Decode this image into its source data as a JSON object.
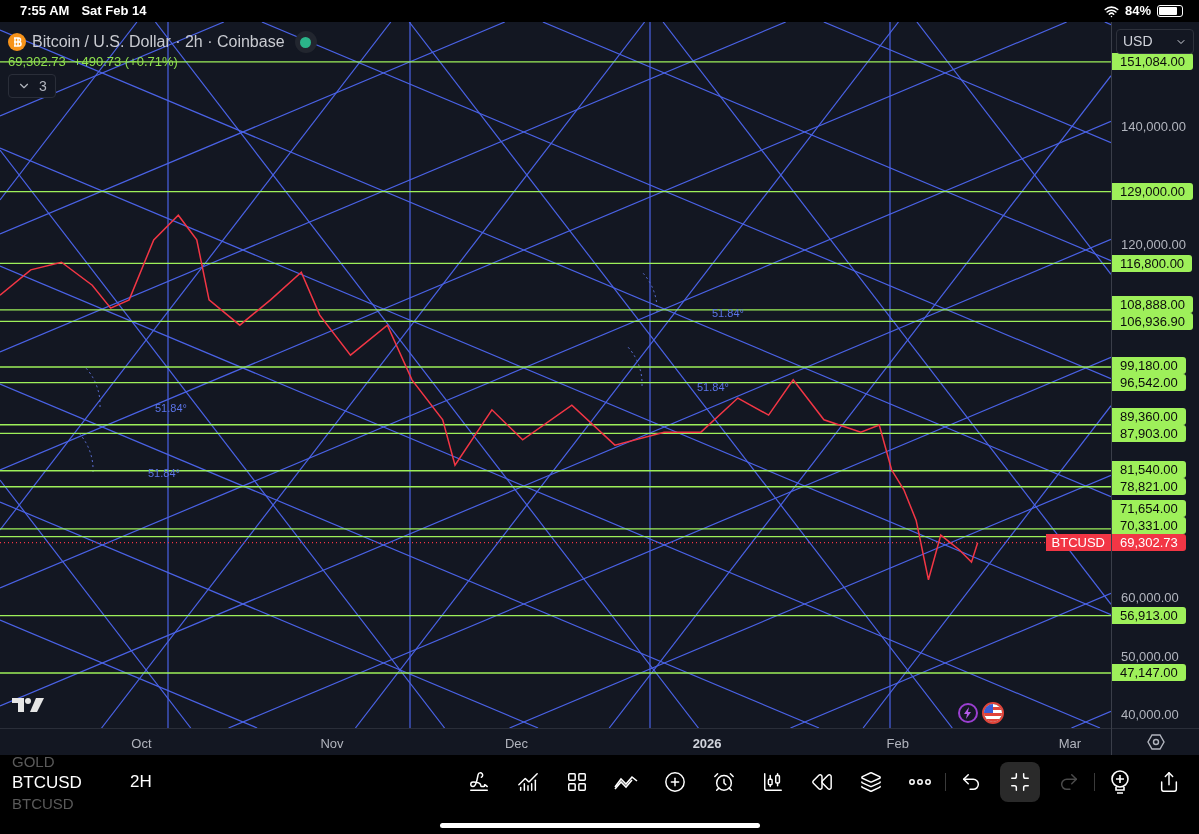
{
  "status_bar": {
    "time": "7:55 AM",
    "date": "Sat Feb 14",
    "battery": "84%"
  },
  "header": {
    "title": "Bitcoin / U.S. Dollar · 2h · Coinbase",
    "market_open": true,
    "price": "69,302.73",
    "change": "+490.73 (+0.71%)",
    "indicators_toggle": {
      "count": "3",
      "expanded": false
    }
  },
  "currency_select": {
    "value": "USD"
  },
  "chart": {
    "chart_data": {
      "type": "line",
      "x": [
        "2025-09-08",
        "2025-09-13",
        "2025-09-18",
        "2025-09-23",
        "2025-09-26",
        "2025-09-29",
        "2025-10-03",
        "2025-10-07",
        "2025-10-10",
        "2025-10-12",
        "2025-10-17",
        "2025-10-22",
        "2025-10-27",
        "2025-10-30",
        "2025-11-04",
        "2025-11-10",
        "2025-11-14",
        "2025-11-19",
        "2025-11-21",
        "2025-11-27",
        "2025-12-02",
        "2025-12-10",
        "2025-12-17",
        "2025-12-25",
        "2025-12-31",
        "2026-01-06",
        "2026-01-11",
        "2026-01-15",
        "2026-01-20",
        "2026-01-26",
        "2026-01-29",
        "2026-01-31",
        "2026-02-02",
        "2026-02-04",
        "2026-02-06",
        "2026-02-08",
        "2026-02-11",
        "2026-02-13",
        "2026-02-14"
      ],
      "series": [
        {
          "name": "BTCUSD",
          "color": "#f23645",
          "values": [
            111400,
            115700,
            117000,
            113100,
            109200,
            110600,
            120800,
            125000,
            120800,
            110600,
            106300,
            110600,
            115300,
            108000,
            101200,
            106300,
            97000,
            90200,
            82500,
            91900,
            86800,
            92700,
            85900,
            88100,
            88100,
            93900,
            91000,
            97000,
            90200,
            88100,
            89300,
            81700,
            78300,
            73100,
            63000,
            70600,
            68100,
            66000,
            69300
          ]
        }
      ],
      "xlim": [
        "2025-09-08",
        "2026-03-22"
      ],
      "ylim": [
        37789,
        157857
      ],
      "xticks": [
        {
          "value": "2025-10-01",
          "label": "Oct"
        },
        {
          "value": "2025-11-01",
          "label": "Nov"
        },
        {
          "value": "2025-12-01",
          "label": "Dec"
        },
        {
          "value": "2026-01-01",
          "label": "2026"
        },
        {
          "value": "2026-02-01",
          "label": "Feb"
        },
        {
          "value": "2026-03-01",
          "label": "Mar"
        }
      ],
      "yticks": [
        {
          "value": 140000,
          "label": "140,000.00"
        },
        {
          "value": 120000,
          "label": "120,000.00"
        },
        {
          "value": 60000,
          "label": "60,000.00"
        },
        {
          "value": 50000,
          "label": "50,000.00"
        },
        {
          "value": 40000,
          "label": "40,000.00"
        }
      ],
      "ref_lines": [
        {
          "axis": "y",
          "value": 151084,
          "label": "151,084.00",
          "color": "#9ef05a"
        },
        {
          "axis": "y",
          "value": 129000,
          "label": "129,000.00",
          "color": "#9ef05a"
        },
        {
          "axis": "y",
          "value": 116800,
          "label": "116,800.00",
          "color": "#9ef05a"
        },
        {
          "axis": "y",
          "value": 108888,
          "label": "108,888.00",
          "color": "#9ef05a"
        },
        {
          "axis": "y",
          "value": 106936.9,
          "label": "106,936.90",
          "color": "#9ef05a"
        },
        {
          "axis": "y",
          "value": 99180,
          "label": "99,180.00",
          "color": "#9ef05a"
        },
        {
          "axis": "y",
          "value": 96542,
          "label": "96,542.00",
          "color": "#9ef05a"
        },
        {
          "axis": "y",
          "value": 89360,
          "label": "89,360.00",
          "color": "#9ef05a"
        },
        {
          "axis": "y",
          "value": 87903,
          "label": "87,903.00",
          "color": "#9ef05a"
        },
        {
          "axis": "y",
          "value": 81540,
          "label": "81,540.00",
          "color": "#9ef05a"
        },
        {
          "axis": "y",
          "value": 78821,
          "label": "78,821.00",
          "color": "#9ef05a"
        },
        {
          "axis": "y",
          "value": 71654,
          "label": "71,654.00",
          "color": "#9ef05a"
        },
        {
          "axis": "y",
          "value": 70331,
          "label": "70,331.00",
          "color": "#9ef05a"
        },
        {
          "axis": "y",
          "value": 69302.73,
          "label": "69,302.73",
          "color": "#f23645"
        },
        {
          "axis": "y",
          "value": 56913,
          "label": "56,913.00",
          "color": "#9ef05a"
        },
        {
          "axis": "y",
          "value": 47147,
          "label": "47,147.00",
          "color": "#9ef05a"
        }
      ]
    },
    "angle_labels": [
      "51.84°",
      "51.84°",
      "51.84°",
      "51.84°"
    ]
  },
  "toolbar": {
    "symbols": [
      {
        "label": "GOLD",
        "selected": false
      },
      {
        "label": "BTCUSD",
        "selected": true
      },
      {
        "label": "BTCUSD",
        "selected": false
      }
    ],
    "interval": "2H",
    "tools": [
      {
        "kind": "draw",
        "active": false,
        "disabled": false
      },
      {
        "kind": "indicators",
        "active": false,
        "disabled": false
      },
      {
        "kind": "layout",
        "active": false,
        "disabled": false
      },
      {
        "kind": "patterns",
        "active": false,
        "disabled": false
      },
      {
        "kind": "add",
        "active": false,
        "disabled": false
      },
      {
        "kind": "alert",
        "active": false,
        "disabled": false
      },
      {
        "kind": "chart_type",
        "active": false,
        "disabled": false
      },
      {
        "kind": "replay",
        "active": false,
        "disabled": false
      },
      {
        "kind": "layers",
        "active": false,
        "disabled": false
      },
      {
        "kind": "more",
        "active": false,
        "disabled": false
      },
      {
        "kind": "separator"
      },
      {
        "kind": "undo",
        "active": false,
        "disabled": false
      },
      {
        "kind": "fullscreen",
        "active": true,
        "disabled": false
      },
      {
        "kind": "redo",
        "active": false,
        "disabled": true
      },
      {
        "kind": "separator"
      },
      {
        "kind": "ideas",
        "active": false,
        "disabled": false
      },
      {
        "kind": "share",
        "active": false,
        "disabled": false
      }
    ]
  }
}
